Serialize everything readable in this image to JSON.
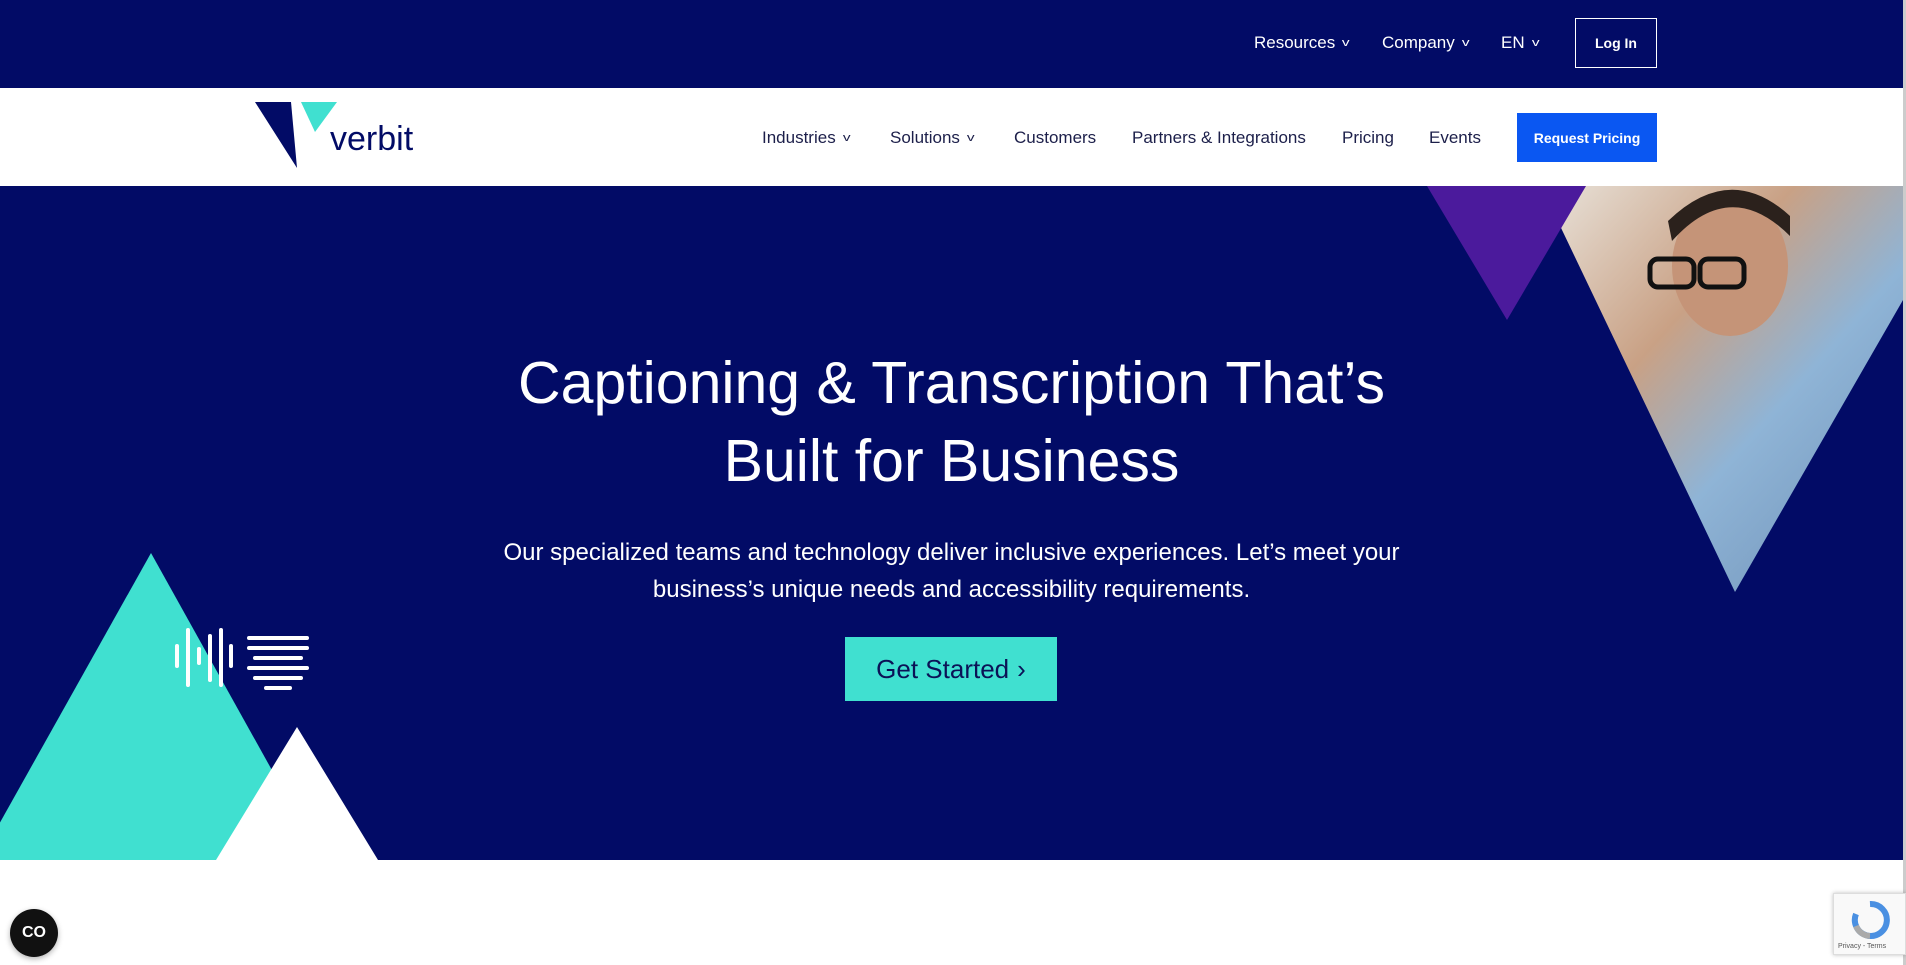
{
  "topbar": {
    "items": [
      {
        "label": "Resources"
      },
      {
        "label": "Company"
      },
      {
        "label": "EN"
      }
    ],
    "login_label": "Log In"
  },
  "navbar": {
    "logo_text": "verbit",
    "items": [
      {
        "label": "Industries",
        "has_dropdown": true
      },
      {
        "label": "Solutions",
        "has_dropdown": true
      },
      {
        "label": "Customers"
      },
      {
        "label": "Partners & Integrations"
      },
      {
        "label": "Pricing"
      },
      {
        "label": "Events"
      }
    ],
    "cta_label": "Request Pricing"
  },
  "hero": {
    "title_line1": "Captioning & Transcription That’s",
    "title_line2": "Built for Business",
    "subtitle_line1": "Our specialized teams and technology deliver inclusive experiences. Let’s meet your",
    "subtitle_line2": "business’s unique needs and accessibility requirements.",
    "cta_label": "Get Started",
    "cta_icon": "›"
  },
  "widgets": {
    "accessibility_label": "CO",
    "recaptcha_label": "Privacy - Terms"
  },
  "colors": {
    "navy": "#020b66",
    "teal": "#40e0d0",
    "blue": "#0a57f2",
    "purple": "#4b1a9c"
  }
}
